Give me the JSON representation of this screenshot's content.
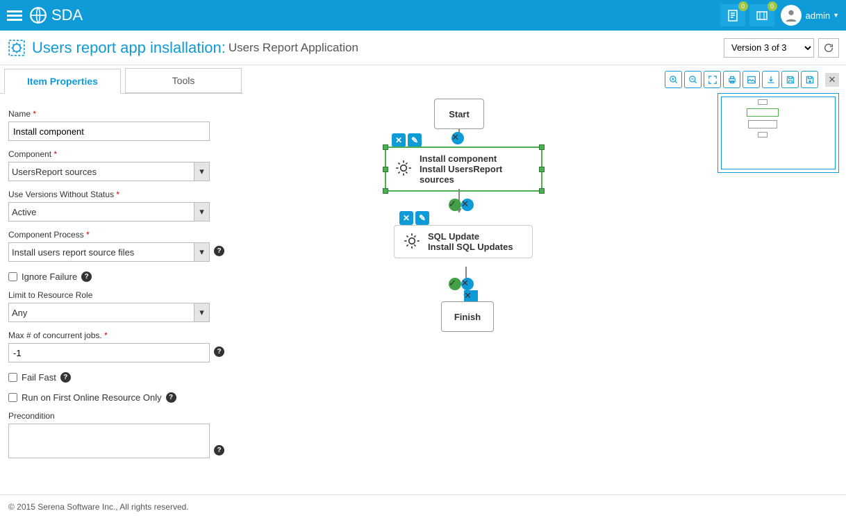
{
  "topbar": {
    "app_name": "SDA",
    "badge1": "0",
    "badge2": "0",
    "username": "admin"
  },
  "subheader": {
    "title_main": "Users report app inslallation:",
    "title_sub": "Users Report Application",
    "version_select": "Version 3 of 3"
  },
  "tabs": {
    "props": "Item Properties",
    "tools": "Tools"
  },
  "form": {
    "name_label": "Name",
    "name_value": "Install component",
    "component_label": "Component",
    "component_value": "UsersReport sources",
    "versions_label": "Use Versions Without Status",
    "versions_value": "Active",
    "process_label": "Component Process",
    "process_value": "Install users report source files",
    "ignore_failure_label": "Ignore Failure",
    "limit_label": "Limit to Resource Role",
    "limit_value": "Any",
    "max_label": "Max # of concurrent jobs.",
    "max_value": "-1",
    "fail_fast_label": "Fail Fast",
    "run_first_label": "Run on First Online Resource Only",
    "precondition_label": "Precondition"
  },
  "canvas": {
    "start": "Start",
    "finish": "Finish",
    "node1_line1": "Install component",
    "node1_line2": "Install UsersReport sources",
    "node2_line1": "SQL Update",
    "node2_line2": "Install SQL Updates"
  },
  "footer": {
    "copyright": "© 2015 Serena Software Inc., All rights reserved."
  }
}
